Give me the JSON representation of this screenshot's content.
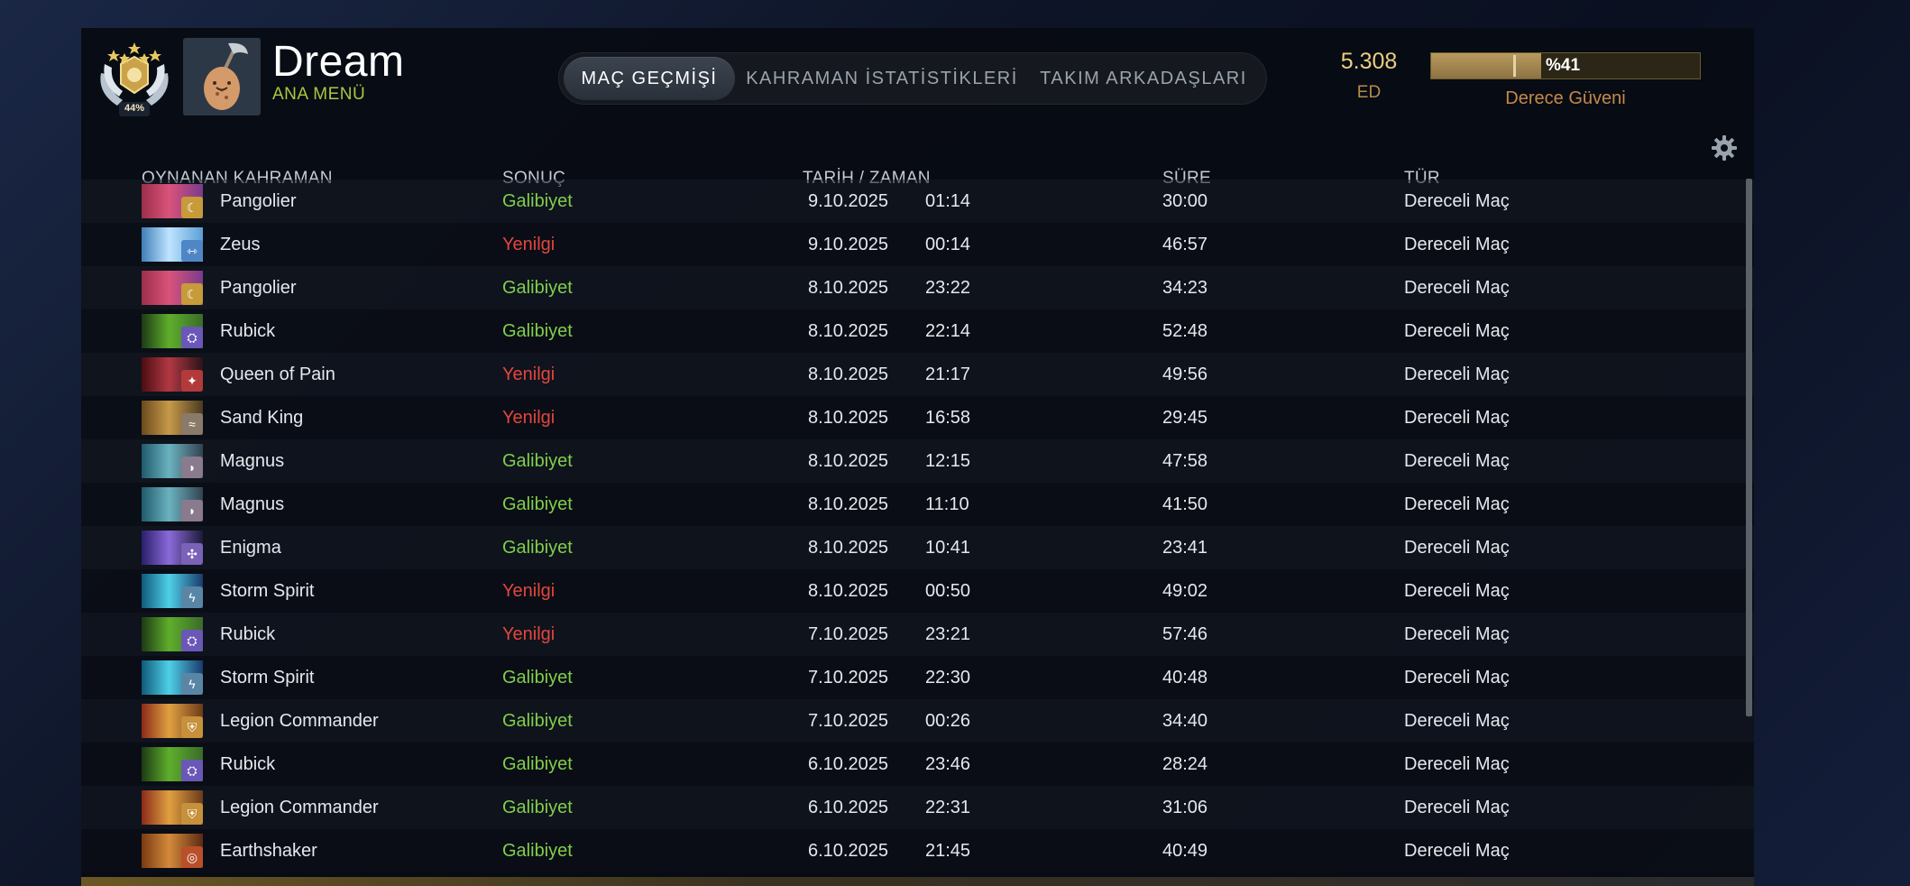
{
  "colors": {
    "win": "#7fcf4b",
    "loss": "#e2463d",
    "accent_green": "#a9c83e",
    "mmr_gold": "#e9cf7f",
    "confidence_label": "#c4894a"
  },
  "profile": {
    "medal_icon": "rank-medal-icon",
    "medal_text": "44%",
    "avatar_icon": "egg-avatar-icon",
    "name": "Dream",
    "subtitle": "ANA MENÜ"
  },
  "tabs": [
    {
      "label": "MAÇ GEÇMİŞİ",
      "active": true
    },
    {
      "label": "KAHRAMAN İSTATİSTİKLERİ",
      "active": false
    },
    {
      "label": "TAKIM ARKADAŞLARI",
      "active": false
    }
  ],
  "mmr": {
    "value": "5.308",
    "label": "ED"
  },
  "rank_confidence": {
    "text": "%41",
    "fraction": 0.41,
    "label": "Derece Güveni"
  },
  "columns": {
    "hero": "OYNANAN KAHRAMAN",
    "result": "SONUÇ",
    "datetime": "TARİH / ZAMAN",
    "duration": "SÜRE",
    "type": "TÜR",
    "settings_icon": "gear-icon"
  },
  "matches": [
    {
      "hero": "Pangolier",
      "result": "Galibiyet",
      "win": true,
      "date": "9.10.2025",
      "time": "01:14",
      "duration": "30:00",
      "type": "Dereceli Maç"
    },
    {
      "hero": "Zeus",
      "result": "Yenilgi",
      "win": false,
      "date": "9.10.2025",
      "time": "00:14",
      "duration": "46:57",
      "type": "Dereceli Maç"
    },
    {
      "hero": "Pangolier",
      "result": "Galibiyet",
      "win": true,
      "date": "8.10.2025",
      "time": "23:22",
      "duration": "34:23",
      "type": "Dereceli Maç"
    },
    {
      "hero": "Rubick",
      "result": "Galibiyet",
      "win": true,
      "date": "8.10.2025",
      "time": "22:14",
      "duration": "52:48",
      "type": "Dereceli Maç"
    },
    {
      "hero": "Queen of Pain",
      "result": "Yenilgi",
      "win": false,
      "date": "8.10.2025",
      "time": "21:17",
      "duration": "49:56",
      "type": "Dereceli Maç"
    },
    {
      "hero": "Sand King",
      "result": "Yenilgi",
      "win": false,
      "date": "8.10.2025",
      "time": "16:58",
      "duration": "29:45",
      "type": "Dereceli Maç"
    },
    {
      "hero": "Magnus",
      "result": "Galibiyet",
      "win": true,
      "date": "8.10.2025",
      "time": "12:15",
      "duration": "47:58",
      "type": "Dereceli Maç"
    },
    {
      "hero": "Magnus",
      "result": "Galibiyet",
      "win": true,
      "date": "8.10.2025",
      "time": "11:10",
      "duration": "41:50",
      "type": "Dereceli Maç"
    },
    {
      "hero": "Enigma",
      "result": "Galibiyet",
      "win": true,
      "date": "8.10.2025",
      "time": "10:41",
      "duration": "23:41",
      "type": "Dereceli Maç"
    },
    {
      "hero": "Storm Spirit",
      "result": "Yenilgi",
      "win": false,
      "date": "8.10.2025",
      "time": "00:50",
      "duration": "49:02",
      "type": "Dereceli Maç"
    },
    {
      "hero": "Rubick",
      "result": "Yenilgi",
      "win": false,
      "date": "7.10.2025",
      "time": "23:21",
      "duration": "57:46",
      "type": "Dereceli Maç"
    },
    {
      "hero": "Storm Spirit",
      "result": "Galibiyet",
      "win": true,
      "date": "7.10.2025",
      "time": "22:30",
      "duration": "40:48",
      "type": "Dereceli Maç"
    },
    {
      "hero": "Legion Commander",
      "result": "Galibiyet",
      "win": true,
      "date": "7.10.2025",
      "time": "00:26",
      "duration": "34:40",
      "type": "Dereceli Maç"
    },
    {
      "hero": "Rubick",
      "result": "Galibiyet",
      "win": true,
      "date": "6.10.2025",
      "time": "23:46",
      "duration": "28:24",
      "type": "Dereceli Maç"
    },
    {
      "hero": "Legion Commander",
      "result": "Galibiyet",
      "win": true,
      "date": "6.10.2025",
      "time": "22:31",
      "duration": "31:06",
      "type": "Dereceli Maç"
    },
    {
      "hero": "Earthshaker",
      "result": "Galibiyet",
      "win": true,
      "date": "6.10.2025",
      "time": "21:45",
      "duration": "40:49",
      "type": "Dereceli Maç"
    }
  ]
}
